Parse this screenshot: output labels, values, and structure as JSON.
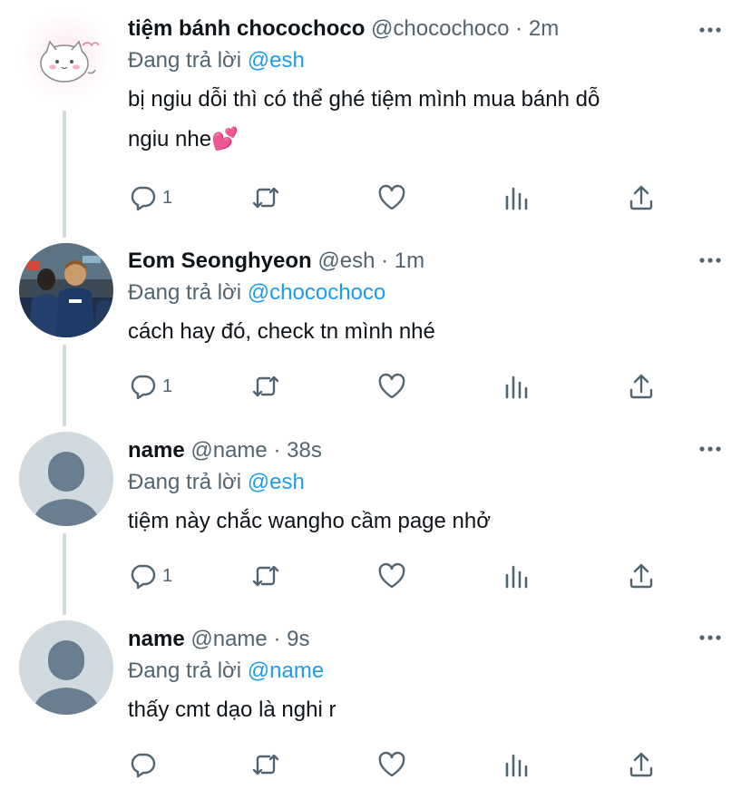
{
  "tweets": [
    {
      "display_name": "tiệm bánh chocochoco",
      "handle": "@chocochoco",
      "dot": "·",
      "time": "2m",
      "reply_prefix": "Đang trả lời",
      "reply_to": "@esh",
      "text_line1": "bị ngiu dỗi thì có thể ghé tiệm mình mua bánh dỗ",
      "text_line2": "ngiu nhe💕",
      "reply_count": "1",
      "avatar": "cat-sticker-avatar"
    },
    {
      "display_name": "Eom Seonghyeon",
      "handle": "@esh",
      "dot": "·",
      "time": "1m",
      "reply_prefix": "Đang trả lời",
      "reply_to": "@chocochoco",
      "text_line1": "cách hay đó, check tn mình nhé",
      "reply_count": "1",
      "avatar": "photo-avatar"
    },
    {
      "display_name": "name",
      "handle": "@name",
      "dot": "·",
      "time": "38s",
      "reply_prefix": "Đang trả lời",
      "reply_to": "@esh",
      "text_line1": "tiệm này chắc wangho cầm page nhở",
      "reply_count": "1",
      "avatar": "default-avatar"
    },
    {
      "display_name": "name",
      "handle": "@name",
      "dot": "·",
      "time": "9s",
      "reply_prefix": "Đang trả lời",
      "reply_to": "@name",
      "text_line1": "thấy cmt dạo là nghi r",
      "reply_count": "",
      "avatar": "default-avatar"
    }
  ],
  "colors": {
    "accent": "#1d9bf0",
    "secondary_text": "#536471",
    "thread_line": "#cfd9de",
    "default_avatar_bg": "#cfd9de",
    "default_avatar_fg": "#6b7e8f"
  }
}
